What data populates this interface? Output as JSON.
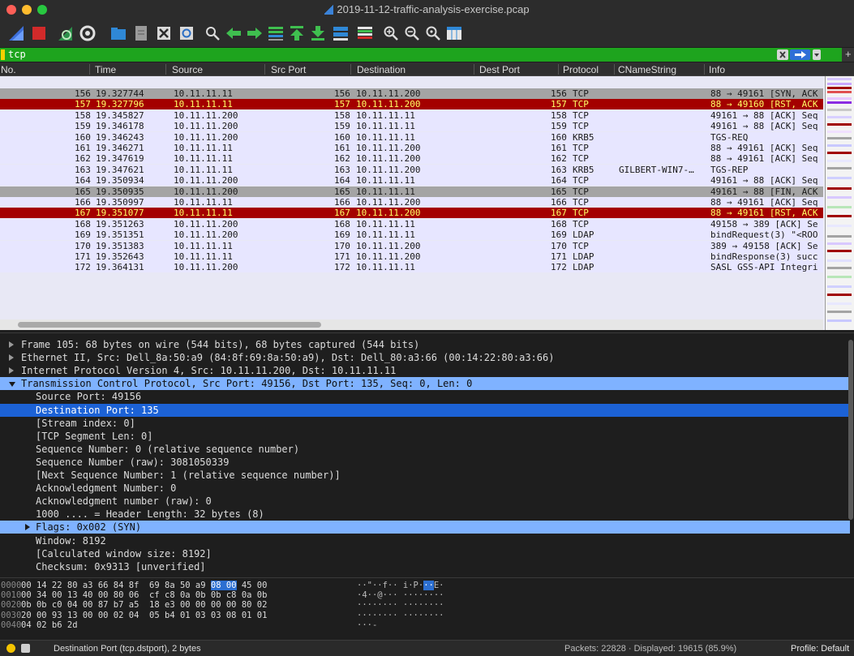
{
  "window": {
    "title": "2019-11-12-traffic-analysis-exercise.pcap"
  },
  "toolbar": {
    "buttons": [
      {
        "icon": "shark-fin-start-icon"
      },
      {
        "icon": "stop-square-icon"
      },
      {
        "icon": "restart-capture-icon"
      },
      {
        "icon": "capture-options-gear-icon"
      },
      {
        "icon": "open-folder-icon"
      },
      {
        "icon": "save-file-icon"
      },
      {
        "icon": "close-file-icon"
      },
      {
        "icon": "reload-file-icon"
      },
      {
        "icon": "find-packet-icon"
      },
      {
        "icon": "go-back-icon"
      },
      {
        "icon": "go-forward-icon"
      },
      {
        "icon": "go-to-packet-icon"
      },
      {
        "icon": "go-first-icon"
      },
      {
        "icon": "go-last-icon"
      },
      {
        "icon": "auto-scroll-icon"
      },
      {
        "icon": "colorize-icon"
      },
      {
        "icon": "zoom-in-icon"
      },
      {
        "icon": "zoom-out-icon"
      },
      {
        "icon": "zoom-normal-icon"
      },
      {
        "icon": "resize-columns-icon"
      }
    ]
  },
  "filter": {
    "value": "tcp",
    "plus": "+"
  },
  "columns": [
    "No.",
    "Time",
    "Source",
    "Src Port",
    "Destination",
    "Dest Port",
    "Protocol",
    "CNameString",
    "Info"
  ],
  "packets": [
    {
      "no": "156",
      "time": "19.327744",
      "src": "10.11.11.11",
      "dst_no": "156",
      "dst": "10.11.11.200",
      "proto_no": "156",
      "proto": "TCP",
      "cname": "",
      "info": "88 → 49161 [SYN, ACK",
      "style": "gray"
    },
    {
      "no": "157",
      "time": "19.327796",
      "src": "10.11.11.11",
      "dst_no": "157",
      "dst": "10.11.11.200",
      "proto_no": "157",
      "proto": "TCP",
      "cname": "",
      "info": "88 → 49160 [RST, ACK",
      "style": "red"
    },
    {
      "no": "158",
      "time": "19.345827",
      "src": "10.11.11.200",
      "dst_no": "158",
      "dst": "10.11.11.11",
      "proto_no": "158",
      "proto": "TCP",
      "cname": "",
      "info": "49161 → 88 [ACK] Seq",
      "style": "normal"
    },
    {
      "no": "159",
      "time": "19.346178",
      "src": "10.11.11.200",
      "dst_no": "159",
      "dst": "10.11.11.11",
      "proto_no": "159",
      "proto": "TCP",
      "cname": "",
      "info": "49161 → 88 [ACK] Seq",
      "style": "normal"
    },
    {
      "no": "160",
      "time": "19.346243",
      "src": "10.11.11.200",
      "dst_no": "160",
      "dst": "10.11.11.11",
      "proto_no": "160",
      "proto": "KRB5",
      "cname": "",
      "info": "TGS-REQ",
      "style": "normal"
    },
    {
      "no": "161",
      "time": "19.346271",
      "src": "10.11.11.11",
      "dst_no": "161",
      "dst": "10.11.11.200",
      "proto_no": "161",
      "proto": "TCP",
      "cname": "",
      "info": "88 → 49161 [ACK] Seq",
      "style": "normal"
    },
    {
      "no": "162",
      "time": "19.347619",
      "src": "10.11.11.11",
      "dst_no": "162",
      "dst": "10.11.11.200",
      "proto_no": "162",
      "proto": "TCP",
      "cname": "",
      "info": "88 → 49161 [ACK] Seq",
      "style": "normal"
    },
    {
      "no": "163",
      "time": "19.347621",
      "src": "10.11.11.11",
      "dst_no": "163",
      "dst": "10.11.11.200",
      "proto_no": "163",
      "proto": "KRB5",
      "cname": "GILBERT-WIN7-…",
      "info": "TGS-REP",
      "style": "normal"
    },
    {
      "no": "164",
      "time": "19.350934",
      "src": "10.11.11.200",
      "dst_no": "164",
      "dst": "10.11.11.11",
      "proto_no": "164",
      "proto": "TCP",
      "cname": "",
      "info": "49161 → 88 [ACK] Seq",
      "style": "normal"
    },
    {
      "no": "165",
      "time": "19.350935",
      "src": "10.11.11.200",
      "dst_no": "165",
      "dst": "10.11.11.11",
      "proto_no": "165",
      "proto": "TCP",
      "cname": "",
      "info": "49161 → 88 [FIN, ACK",
      "style": "gray"
    },
    {
      "no": "166",
      "time": "19.350997",
      "src": "10.11.11.11",
      "dst_no": "166",
      "dst": "10.11.11.200",
      "proto_no": "166",
      "proto": "TCP",
      "cname": "",
      "info": "88 → 49161 [ACK] Seq",
      "style": "normal"
    },
    {
      "no": "167",
      "time": "19.351077",
      "src": "10.11.11.11",
      "dst_no": "167",
      "dst": "10.11.11.200",
      "proto_no": "167",
      "proto": "TCP",
      "cname": "",
      "info": "88 → 49161 [RST, ACK",
      "style": "red"
    },
    {
      "no": "168",
      "time": "19.351263",
      "src": "10.11.11.200",
      "dst_no": "168",
      "dst": "10.11.11.11",
      "proto_no": "168",
      "proto": "TCP",
      "cname": "",
      "info": "49158 → 389 [ACK] Se",
      "style": "normal"
    },
    {
      "no": "169",
      "time": "19.351351",
      "src": "10.11.11.200",
      "dst_no": "169",
      "dst": "10.11.11.11",
      "proto_no": "169",
      "proto": "LDAP",
      "cname": "",
      "info": "bindRequest(3) \"<ROO",
      "style": "normal"
    },
    {
      "no": "170",
      "time": "19.351383",
      "src": "10.11.11.11",
      "dst_no": "170",
      "dst": "10.11.11.200",
      "proto_no": "170",
      "proto": "TCP",
      "cname": "",
      "info": "389 → 49158 [ACK] Se",
      "style": "normal"
    },
    {
      "no": "171",
      "time": "19.352643",
      "src": "10.11.11.11",
      "dst_no": "171",
      "dst": "10.11.11.200",
      "proto_no": "171",
      "proto": "LDAP",
      "cname": "",
      "info": "bindResponse(3) succ",
      "style": "normal"
    },
    {
      "no": "172",
      "time": "19.364131",
      "src": "10.11.11.200",
      "dst_no": "172",
      "dst": "10.11.11.11",
      "proto_no": "172",
      "proto": "LDAP",
      "cname": "",
      "info": "SASL GSS-API Integri",
      "style": "normal"
    }
  ],
  "detail": [
    {
      "text": "Frame 105: 68 bytes on wire (544 bits), 68 bytes captured (544 bits)",
      "indent": 0,
      "expander": "collapsed",
      "style": "normal"
    },
    {
      "text": "Ethernet II, Src: Dell_8a:50:a9 (84:8f:69:8a:50:a9), Dst: Dell_80:a3:66 (00:14:22:80:a3:66)",
      "indent": 0,
      "expander": "collapsed",
      "style": "normal"
    },
    {
      "text": "Internet Protocol Version 4, Src: 10.11.11.200, Dst: 10.11.11.11",
      "indent": 0,
      "expander": "collapsed",
      "style": "normal"
    },
    {
      "text": "Transmission Control Protocol, Src Port: 49156, Dst Port: 135, Seq: 0, Len: 0",
      "indent": 0,
      "expander": "expanded",
      "style": "light"
    },
    {
      "text": "Source Port: 49156",
      "indent": 1,
      "expander": "none",
      "style": "normal"
    },
    {
      "text": "Destination Port: 135",
      "indent": 1,
      "expander": "none",
      "style": "selected"
    },
    {
      "text": "[Stream index: 0]",
      "indent": 1,
      "expander": "none",
      "style": "normal"
    },
    {
      "text": "[TCP Segment Len: 0]",
      "indent": 1,
      "expander": "none",
      "style": "normal"
    },
    {
      "text": "Sequence Number: 0    (relative sequence number)",
      "indent": 1,
      "expander": "none",
      "style": "normal"
    },
    {
      "text": "Sequence Number (raw): 3081050339",
      "indent": 1,
      "expander": "none",
      "style": "normal"
    },
    {
      "text": "[Next Sequence Number: 1    (relative sequence number)]",
      "indent": 1,
      "expander": "none",
      "style": "normal"
    },
    {
      "text": "Acknowledgment Number: 0",
      "indent": 1,
      "expander": "none",
      "style": "normal"
    },
    {
      "text": "Acknowledgment number (raw): 0",
      "indent": 1,
      "expander": "none",
      "style": "normal"
    },
    {
      "text": "1000 .... = Header Length: 32 bytes (8)",
      "indent": 1,
      "expander": "none",
      "style": "normal"
    },
    {
      "text": "Flags: 0x002 (SYN)",
      "indent": 1,
      "expander": "collapsed",
      "style": "light"
    },
    {
      "text": "Window: 8192",
      "indent": 1,
      "expander": "none",
      "style": "normal"
    },
    {
      "text": "[Calculated window size: 8192]",
      "indent": 1,
      "expander": "none",
      "style": "normal"
    },
    {
      "text": "Checksum: 0x9313 [unverified]",
      "indent": 1,
      "expander": "none",
      "style": "normal"
    }
  ],
  "hex": [
    {
      "offset": "0000",
      "bytes_a": "00 14 22 80 a3 66 84 8f  69 8a 50 a9 ",
      "hl": "08 00",
      "bytes_b": " 45 00",
      "ascii_a": "··\"··f·· i·P·",
      "ascii_hl": "··",
      "ascii_b": "E·"
    },
    {
      "offset": "0010",
      "bytes_a": "00 34 00 13 40 00 80 06  cf c8 0a 0b 0b c8 0a 0b",
      "hl": "",
      "bytes_b": "",
      "ascii_a": "·4··@··· ········",
      "ascii_hl": "",
      "ascii_b": ""
    },
    {
      "offset": "0020",
      "bytes_a": "0b 0b c0 04 00 87 b7 a5  18 e3 00 00 00 00 80 02",
      "hl": "",
      "bytes_b": "",
      "ascii_a": "········ ········",
      "ascii_hl": "",
      "ascii_b": ""
    },
    {
      "offset": "0030",
      "bytes_a": "20 00 93 13 00 00 02 04  05 b4 01 03 03 08 01 01",
      "hl": "",
      "bytes_b": "",
      "ascii_a": "········ ········",
      "ascii_hl": "",
      "ascii_b": ""
    },
    {
      "offset": "0040",
      "bytes_a": "04 02 b6 2d",
      "hl": "",
      "bytes_b": "",
      "ascii_a": "···-",
      "ascii_hl": "",
      "ascii_b": ""
    }
  ],
  "status": {
    "field": "Destination Port (tcp.dstport), 2 bytes",
    "packets": "Packets: 22828 · Displayed: 19615 (85.9%)",
    "profile": "Profile: Default"
  },
  "colors": {
    "red_row": "#a40000",
    "gray_row": "#a4a4a4",
    "normal_row": "#e7e6ff",
    "filter_ok": "#1ea41e",
    "selected_detail": "#1c62d6",
    "light_detail": "#7fb2ff"
  }
}
